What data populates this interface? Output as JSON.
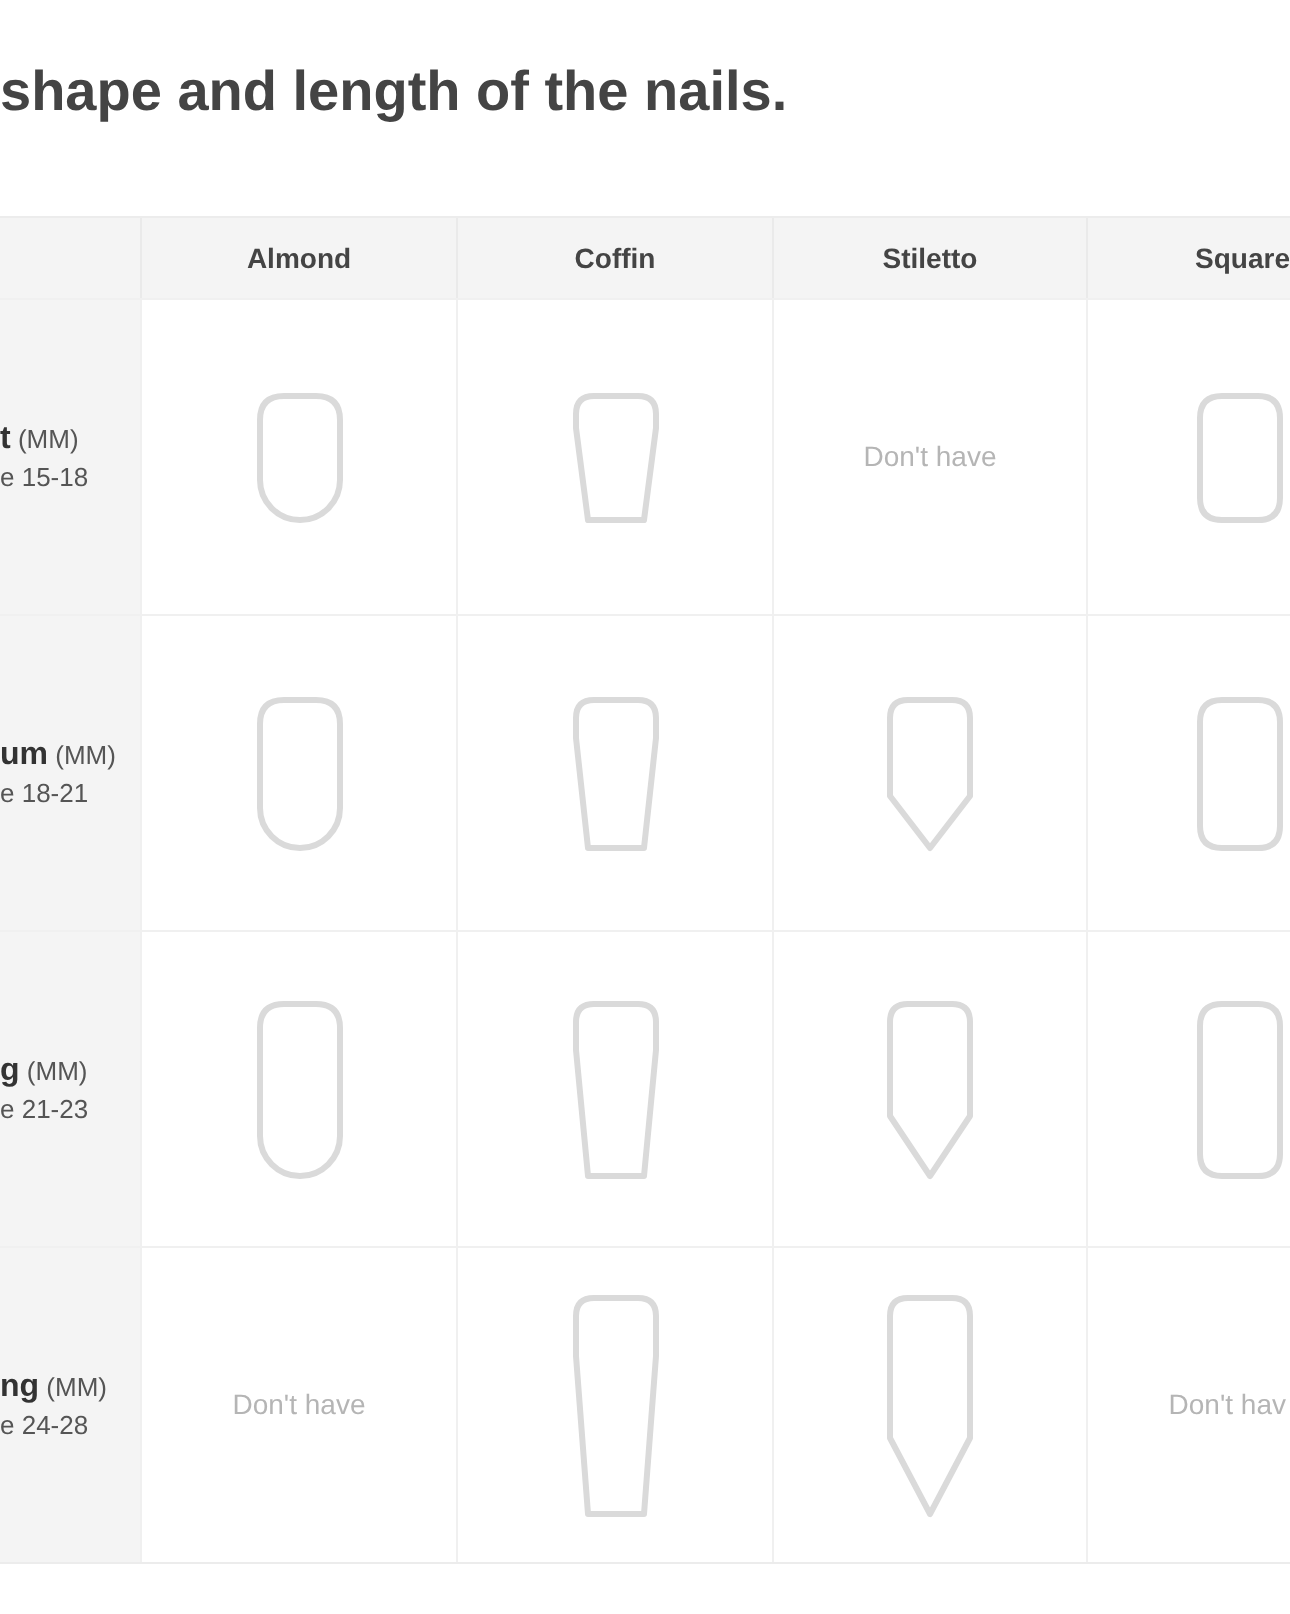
{
  "title": "shape and length of the nails.",
  "table": {
    "columns": [
      "Almond",
      "Coffin",
      "Stiletto",
      "Square"
    ],
    "rows": [
      {
        "label": "t",
        "unit": "(MM)",
        "range": "e 15-18",
        "cells": [
          {
            "kind": "almond"
          },
          {
            "kind": "coffin"
          },
          {
            "kind": "text",
            "text": "Don't have"
          },
          {
            "kind": "square"
          }
        ]
      },
      {
        "label": "um",
        "unit": "(MM)",
        "range": "e 18-21",
        "cells": [
          {
            "kind": "almond"
          },
          {
            "kind": "coffin"
          },
          {
            "kind": "stiletto"
          },
          {
            "kind": "square"
          }
        ]
      },
      {
        "label": "g",
        "unit": "(MM)",
        "range": "e 21-23",
        "cells": [
          {
            "kind": "almond"
          },
          {
            "kind": "coffin"
          },
          {
            "kind": "stiletto"
          },
          {
            "kind": "square"
          }
        ]
      },
      {
        "label": "ng",
        "unit": "(MM)",
        "range": "e 24-28",
        "cells": [
          {
            "kind": "text",
            "text": "Don't have"
          },
          {
            "kind": "coffin"
          },
          {
            "kind": "stiletto"
          },
          {
            "kind": "text",
            "text": "Don't hav"
          }
        ]
      }
    ]
  }
}
